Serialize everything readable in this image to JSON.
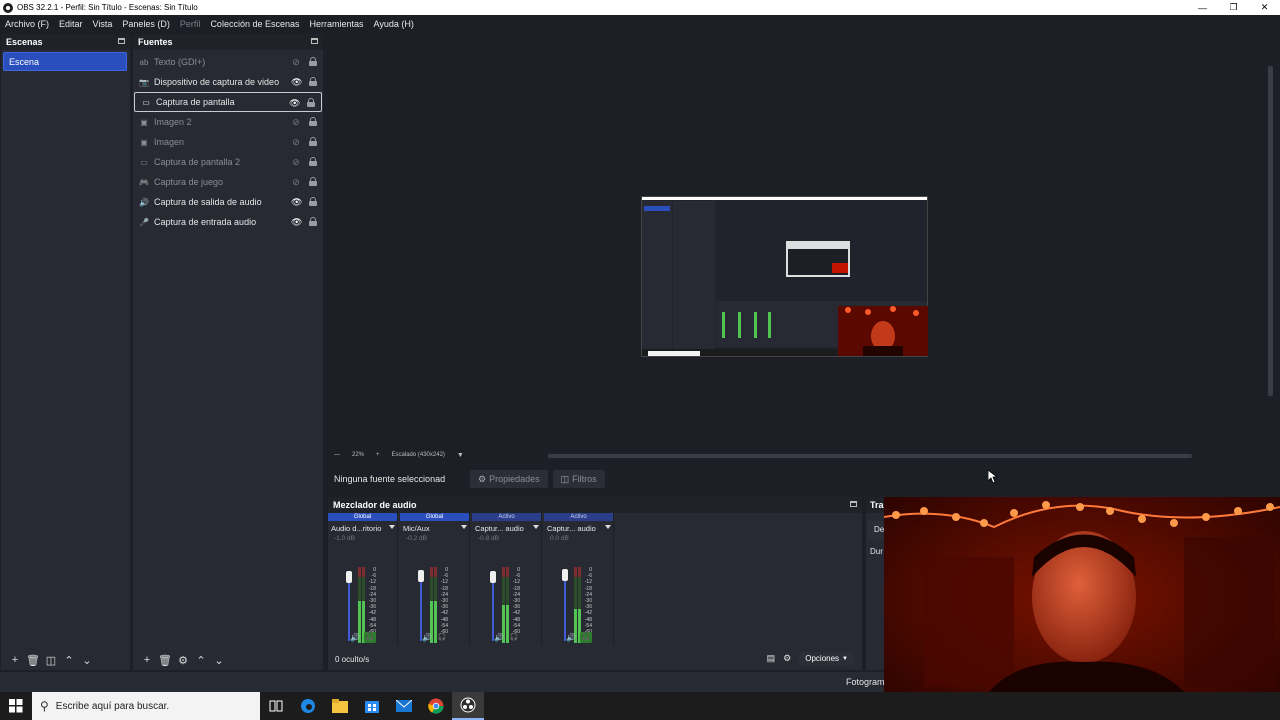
{
  "window": {
    "title": "OBS 32.2.1 - Perfil: Sin Título - Escenas: Sin Título"
  },
  "menu": [
    {
      "label": "Archivo (F)",
      "disabled": false
    },
    {
      "label": "Editar",
      "disabled": false
    },
    {
      "label": "Vista",
      "disabled": false
    },
    {
      "label": "Paneles (D)",
      "disabled": false
    },
    {
      "label": "Perfil",
      "disabled": true
    },
    {
      "label": "Colección de Escenas",
      "disabled": false
    },
    {
      "label": "Herramientas",
      "disabled": false
    },
    {
      "label": "Ayuda (H)",
      "disabled": false
    }
  ],
  "scenes": {
    "title": "Escenas",
    "items": [
      {
        "label": "Escena",
        "selected": true
      }
    ]
  },
  "sources": {
    "title": "Fuentes",
    "items": [
      {
        "label": "Texto (GDI+)",
        "icon": "text-icon",
        "visible": false,
        "selected": false
      },
      {
        "label": "Dispositivo de captura de video",
        "icon": "camera-icon",
        "visible": true,
        "selected": false
      },
      {
        "label": "Captura de pantalla",
        "icon": "monitor-icon",
        "visible": true,
        "selected": true
      },
      {
        "label": "Imagen 2",
        "icon": "image-icon",
        "visible": false,
        "selected": false
      },
      {
        "label": "Imagen",
        "icon": "image-icon",
        "visible": false,
        "selected": false
      },
      {
        "label": "Captura de pantalla 2",
        "icon": "monitor-icon",
        "visible": false,
        "selected": false
      },
      {
        "label": "Captura de juego",
        "icon": "gamepad-icon",
        "visible": false,
        "selected": false
      },
      {
        "label": "Captura de salida de audio",
        "icon": "speaker-icon",
        "visible": true,
        "selected": false
      },
      {
        "label": "Captura de entrada audio",
        "icon": "microphone-icon",
        "visible": true,
        "selected": false
      }
    ]
  },
  "preview": {
    "zoom": "22%",
    "scale_mode": "Escalado (430x242)"
  },
  "context": {
    "no_source": "Ninguna fuente seleccionad",
    "properties": "Propiedades",
    "filters": "Filtros"
  },
  "mixer": {
    "title": "Mezclador de audio",
    "hidden": "0 oculto/s",
    "options": "Opciones",
    "channels": [
      {
        "badge": "Global",
        "name": "Audio d...ritorio",
        "db": "-1.0 dB",
        "level": 0.55,
        "fader": 0.92,
        "monitor_on": true
      },
      {
        "badge": "Global",
        "name": "Mic/Aux",
        "db": "-0.2 dB",
        "level": 0.55,
        "fader": 0.93,
        "monitor_on": false
      },
      {
        "badge": "Activo",
        "name": "Captur... audio",
        "db": "-0.8 dB",
        "level": 0.5,
        "fader": 0.92,
        "monitor_on": false
      },
      {
        "badge": "Activo",
        "name": "Captur... audio",
        "db": "0.0 dB",
        "level": 0.45,
        "fader": 0.95,
        "monitor_on": true
      }
    ],
    "scale": [
      "0",
      "-6",
      "-12",
      "-18",
      "-24",
      "-30",
      "-36",
      "-42",
      "-48",
      "-54",
      "-60"
    ]
  },
  "transitions": {
    "title": "Tra",
    "row": "De",
    "duration": "Dur"
  },
  "status": {
    "fps": "Fotogram"
  },
  "taskbar": {
    "search_placeholder": "Escribe aquí para buscar."
  }
}
